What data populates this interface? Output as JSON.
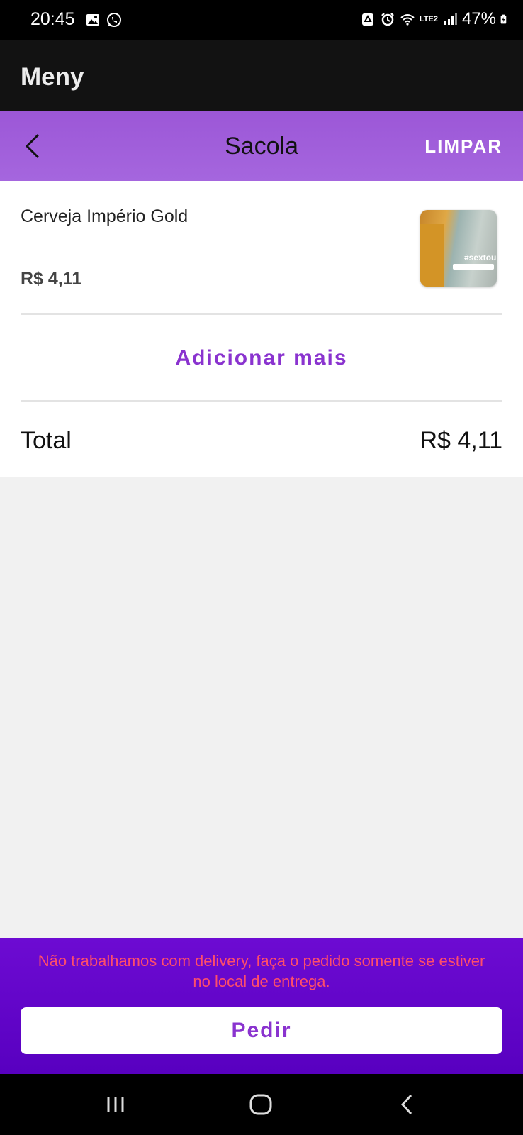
{
  "status_bar": {
    "time": "20:45",
    "battery": "47%",
    "network": "LTE2"
  },
  "app_bar": {
    "title": "Meny"
  },
  "header": {
    "title": "Sacola",
    "clear_label": "LIMPAR"
  },
  "cart": {
    "items": [
      {
        "name": "Cerveja Império Gold",
        "price": "R$ 4,11",
        "thumb_tag": "#sextou"
      }
    ],
    "add_more_label": "Adicionar mais",
    "total_label": "Total",
    "total_value": "R$ 4,11"
  },
  "footer": {
    "note": "Não trabalhamos com delivery, faça o pedido somente se estiver no local de entrega.",
    "order_label": "Pedir"
  },
  "colors": {
    "accent": "#8a33cf",
    "header_bg": "#a566de",
    "footer_bg": "#6d0bd2",
    "warning_text": "#ff4e6a"
  }
}
